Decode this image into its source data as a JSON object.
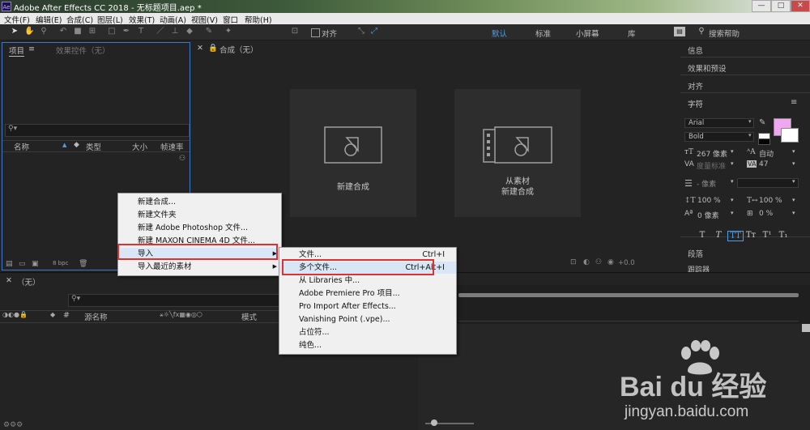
{
  "window": {
    "title": "Adobe After Effects CC 2018 - 无标题项目.aep *",
    "app_icon_text": "Ae",
    "buttons": [
      "—",
      "□",
      "✕"
    ]
  },
  "menubar": [
    "文件(F)",
    "编辑(E)",
    "合成(C)",
    "图层(L)",
    "效果(T)",
    "动画(A)",
    "视图(V)",
    "窗口",
    "帮助(H)"
  ],
  "toolbar": {
    "align_label": "对齐",
    "workspaces": [
      "默认",
      "标准",
      "小屏幕",
      "库"
    ],
    "search_placeholder": "搜索帮助"
  },
  "project_panel": {
    "tab_project": "项目",
    "tab_effects": "效果控件（无）",
    "columns": [
      "名称",
      "类型",
      "大小",
      "帧速率"
    ],
    "bpc": "8 bpc"
  },
  "comp_panel": {
    "tab": "合成（无）",
    "new_comp": "新建合成",
    "from_footage_line1": "从素材",
    "from_footage_line2": "新建合成",
    "zoom_value": "+0.0"
  },
  "context_menu": {
    "items": [
      {
        "label": "新建合成..."
      },
      {
        "label": "新建文件夹"
      },
      {
        "label": "新建 Adobe Photoshop 文件..."
      },
      {
        "label": "新建 MAXON CINEMA 4D 文件..."
      },
      {
        "label": "导入",
        "submenu": true
      },
      {
        "label": "导入最近的素材",
        "submenu": true
      }
    ]
  },
  "submenu": {
    "items": [
      {
        "label": "文件...",
        "shortcut": "Ctrl+I"
      },
      {
        "label": "多个文件...",
        "shortcut": "Ctrl+Alt+I"
      },
      {
        "label": "从 Libraries 中..."
      },
      {
        "label": "Adobe Premiere Pro 项目..."
      },
      {
        "label": "Pro Import After Effects..."
      },
      {
        "label": "Vanishing Point (.vpe)..."
      },
      {
        "label": "占位符..."
      },
      {
        "label": "纯色..."
      }
    ]
  },
  "timeline": {
    "tab": "（无）",
    "columns": [
      "#",
      "源名称",
      "模式"
    ]
  },
  "right_panel": {
    "info": "信息",
    "effects_presets": "效果和预设",
    "align": "对齐",
    "character": "字符",
    "font": "Arial",
    "style": "Bold",
    "font_size": "267 像素",
    "leading": "自动",
    "kerning": "度量标准",
    "tracking": "47",
    "stroke": "- 像素",
    "vscale": "100 %",
    "hscale": "100 %",
    "baseline": "0 像素",
    "tsume": "0 %",
    "type_buttons": [
      "T",
      "T",
      "TT",
      "Tт",
      "T¹",
      "T₁"
    ],
    "paragraph": "段落",
    "tracker": "跟踪器",
    "fill_color": "#f0a6f0"
  },
  "watermark": {
    "brand": "Bai du 经验",
    "url": "jingyan.baidu.com"
  }
}
